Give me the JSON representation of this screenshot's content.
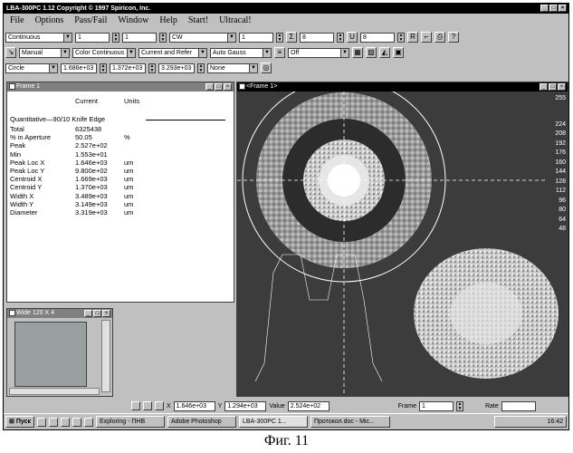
{
  "window": {
    "title": "LBA-300PC   1.12   Copyright © 1997 Spiricon, Inc."
  },
  "menu": [
    "File",
    "Options",
    "Pass/Fail",
    "Window",
    "Help",
    "Start!",
    "Ultracal!"
  ],
  "toolbar1": {
    "mode": "Continuous",
    "v1": "1",
    "v2": "1",
    "dir": "CW",
    "v3": "1",
    "v4": "8",
    "v5": "8"
  },
  "toolbar2": {
    "trigger": "Manual",
    "palette": "Color Continuous",
    "ref": "Current and Refer",
    "fit": "Auto Gauss",
    "off": "Off"
  },
  "toolbar3": {
    "shape": "Circle",
    "x": "1.686e+03",
    "y": "1.372e+03",
    "d": "3.293e+03",
    "none": "None"
  },
  "frame1_window": {
    "title": "Frame 1",
    "headers": {
      "current": "Current",
      "units": "Units"
    },
    "section": "Quantitative—90/10 Knife Edge",
    "rows": [
      {
        "label": "Total",
        "value": "6325438",
        "unit": ""
      },
      {
        "label": "% in Aperture",
        "value": "50.05",
        "unit": "%"
      },
      {
        "label": "Peak",
        "value": "2.527e+02",
        "unit": ""
      },
      {
        "label": "Min",
        "value": "1.553e+01",
        "unit": ""
      },
      {
        "label": "Peak Loc X",
        "value": "1.646e+03",
        "unit": "um"
      },
      {
        "label": "Peak Loc Y",
        "value": "9.800e+02",
        "unit": "um"
      },
      {
        "label": "Centroid X",
        "value": "1.669e+03",
        "unit": "um"
      },
      {
        "label": "Centroid Y",
        "value": "1.370e+03",
        "unit": "um"
      },
      {
        "label": "Width X",
        "value": "3.489e+03",
        "unit": "um"
      },
      {
        "label": "Width Y",
        "value": "3.149e+03",
        "unit": "um"
      },
      {
        "label": "Diameter",
        "value": "3.319e+03",
        "unit": "um"
      }
    ]
  },
  "small_window": {
    "title": "Wide 120 X 4"
  },
  "frame_view": {
    "title": "<Frame 1>",
    "scale": [
      "255",
      "224",
      "208",
      "192",
      "176",
      "160",
      "144",
      "128",
      "112",
      "96",
      "80",
      "64",
      "48"
    ]
  },
  "status": {
    "x_label": "X",
    "x": "1.646e+03",
    "y_label": "Y",
    "y": "1.294e+03",
    "value_label": "Value",
    "value": "2.524e+02",
    "frame_label": "Frame",
    "frame": "1",
    "rate_label": "Rate"
  },
  "taskbar": {
    "start": "Пуск",
    "tasks": [
      "Exploring - ПНВ",
      "Adobe Photoshop",
      "LBA-300PC    1...",
      "Протокол.doc - Mic..."
    ],
    "clock": "16:42"
  },
  "caption": "Фиг. 11"
}
